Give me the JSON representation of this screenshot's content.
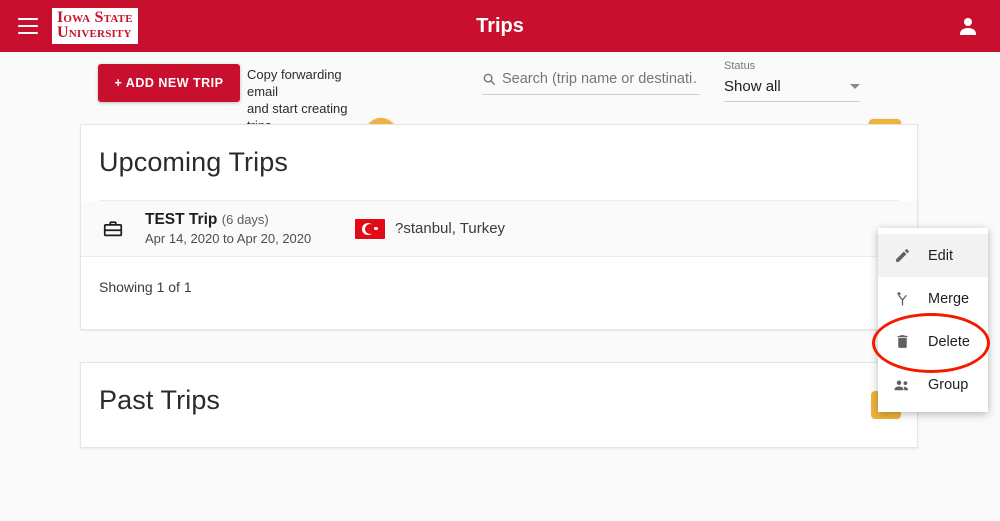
{
  "appbar": {
    "menu_icon": "hamburger-menu-icon",
    "logo_line1": "Iowa State",
    "logo_line2": "University",
    "title": "Trips",
    "account_icon": "person-icon",
    "background_color": "#c8102e"
  },
  "toolbar": {
    "add_trip_label": "+ ADD NEW TRIP",
    "forwarding_text_line1": "Copy forwarding email",
    "forwarding_text_line2": "and start creating trips",
    "link_icon": "link-icon",
    "search": {
      "icon": "search-icon",
      "placeholder": "Search (trip name or destinati…",
      "value": ""
    },
    "status": {
      "label": "Status",
      "value": "Show all",
      "caret_icon": "chevron-down-icon",
      "options": [
        "Show all"
      ]
    },
    "calendar_icon": "calendar-icon",
    "accent_color": "#eeb33b"
  },
  "upcoming": {
    "title": "Upcoming Trips",
    "trip": {
      "icon": "briefcase-icon",
      "name": "TEST Trip",
      "duration": "(6 days)",
      "dates": "Apr 14, 2020 to Apr 20, 2020",
      "flag_icon": "turkey-flag-icon",
      "destination": "?stanbul, Turkey"
    },
    "showing": "Showing 1 of 1"
  },
  "past": {
    "title": "Past Trips"
  },
  "context_menu": {
    "items": [
      {
        "label": "Edit",
        "icon": "pencil-icon"
      },
      {
        "label": "Merge",
        "icon": "call-merge-icon"
      },
      {
        "label": "Delete",
        "icon": "trash-icon"
      },
      {
        "label": "Group",
        "icon": "people-icon"
      }
    ],
    "highlighted_item": "Delete",
    "highlight_color": "#f41a00"
  }
}
